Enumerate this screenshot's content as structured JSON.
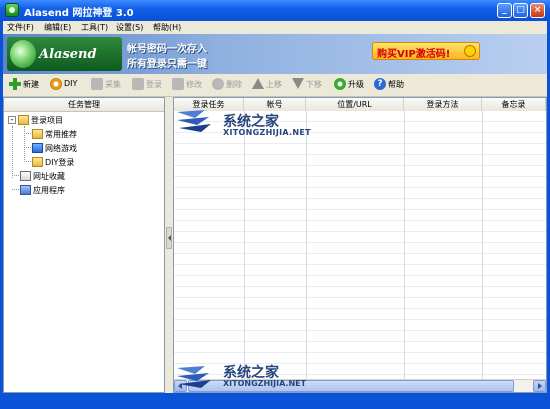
{
  "window": {
    "title": "Alasend 网拉神登 3.0",
    "controls": [
      "_",
      "□",
      "×"
    ]
  },
  "menu": [
    "文件(F)",
    "编辑(E)",
    "工具(T)",
    "设置(S)",
    "帮助(H)"
  ],
  "banner": {
    "logo": "Alasend",
    "slogan1": "帐号密码一次存入",
    "slogan2": "所有登录只需一键",
    "vip": "购买VIP激活码!"
  },
  "toolbar": [
    {
      "label": "新建",
      "icon": "add-icon",
      "enabled": true
    },
    {
      "label": "DIY",
      "icon": "gear-icon",
      "enabled": true
    },
    {
      "label": "采集",
      "icon": "collect-icon",
      "enabled": false
    },
    {
      "label": "登录",
      "icon": "login-icon",
      "enabled": false
    },
    {
      "label": "修改",
      "icon": "edit-icon",
      "enabled": false
    },
    {
      "label": "删除",
      "icon": "delete-icon",
      "enabled": false
    },
    {
      "label": "上移",
      "icon": "arrow-up-icon",
      "enabled": false
    },
    {
      "label": "下移",
      "icon": "arrow-down-icon",
      "enabled": false
    },
    {
      "label": "升级",
      "icon": "upgrade-icon",
      "enabled": true
    },
    {
      "label": "帮助",
      "icon": "help-icon",
      "enabled": true
    }
  ],
  "left_panel": {
    "header": "任务管理",
    "tree": [
      {
        "label": "登录项目",
        "icon": "folder-icon"
      },
      {
        "label": "常用推荐",
        "icon": "folder-icon"
      },
      {
        "label": "网络游戏",
        "icon": "monitor-icon"
      },
      {
        "label": "DIY登录",
        "icon": "folder-icon"
      },
      {
        "label": "网址收藏",
        "icon": "book-icon"
      },
      {
        "label": "应用程序",
        "icon": "apps-icon"
      }
    ]
  },
  "grid": {
    "columns": [
      "登录任务",
      "帐号",
      "位置/URL",
      "登录方法",
      "备忘录"
    ]
  },
  "watermark": {
    "title": "系统之家",
    "subtitle": "XITONGZHIJIA.NET"
  }
}
